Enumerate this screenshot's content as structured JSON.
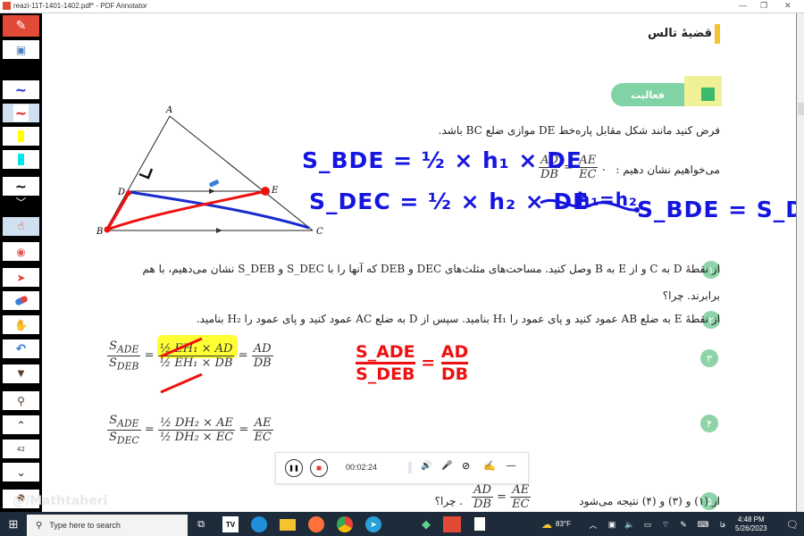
{
  "window": {
    "title": "reazi-11T-1401-1402.pdf* - PDF Annotator",
    "minimize": "—",
    "maximize": "❐",
    "close": "✕"
  },
  "toolbar": {
    "page_number": "42",
    "tools": [
      {
        "name": "app-logo",
        "glyph": "✎"
      },
      {
        "name": "save",
        "glyph": "💾"
      },
      {
        "name": "pen-blue",
        "glyph": "~",
        "color": "#1a2bd0"
      },
      {
        "name": "pen-red",
        "glyph": "~",
        "color": "#e01919"
      },
      {
        "name": "highlighter-yellow",
        "glyph": "▮",
        "color": "#ffff00"
      },
      {
        "name": "highlighter-cyan",
        "glyph": "▮",
        "color": "#00e5ee"
      },
      {
        "name": "pen-black",
        "glyph": "~",
        "color": "#111111"
      },
      {
        "name": "more-pens",
        "glyph": "﹀"
      },
      {
        "name": "hand-pointer",
        "glyph": "☝"
      },
      {
        "name": "laser",
        "glyph": "◉"
      },
      {
        "name": "select-arrow",
        "glyph": "➤"
      },
      {
        "name": "eraser",
        "glyph": "▭"
      },
      {
        "name": "hand-pan",
        "glyph": "✋"
      },
      {
        "name": "undo",
        "glyph": "↶"
      },
      {
        "name": "dropdown",
        "glyph": "▼"
      },
      {
        "name": "zoom",
        "glyph": "🔍"
      },
      {
        "name": "page-up",
        "glyph": "⌃"
      },
      {
        "name": "page-down",
        "glyph": "⌄"
      },
      {
        "name": "settings",
        "glyph": "✹"
      }
    ]
  },
  "page": {
    "heading": "قضیهٔ تالس",
    "activity_label": "فعالیت",
    "intro": "فرض کنید مانند شکل مقابل پاره‌خط DE موازی ضلع BC باشد.",
    "goal_text": "می‌خواهیم نشان دهیم :",
    "goal_fraction": {
      "left_num": "AD",
      "left_den": "DB",
      "right_num": "AE",
      "right_den": "EC"
    },
    "triangle_labels": {
      "A": "A",
      "B": "B",
      "C": "C",
      "D": "D",
      "E": "E"
    },
    "steps": [
      {
        "num": "۱",
        "line1": "از نقطهٔ D به C و از E به B وصل کنید. مساحت‌های مثلث‌های DEC و DEB که آنها را با S_DEC و S_DEB نشان می‌دهیم، با هم",
        "line2": "برابرند. چرا؟"
      },
      {
        "num": "۲",
        "line1": "از نقطهٔ E به ضلع AB عمود کنید و پای عمود را H₁ بنامید. سپس از D به ضلع AC عمود کنید و پای عمود را H₂ بنامید."
      },
      {
        "num": "۳"
      },
      {
        "num": "۴"
      },
      {
        "num": "۵",
        "line1": "از (۱) و (۳) و (۴) نتیجه می‌شود",
        "line2": ". چرا؟"
      }
    ],
    "eq3": {
      "lhs_num": "S",
      "lhs_num_sub": "ADE",
      "lhs_den": "S",
      "lhs_den_sub": "DEB",
      "mid_num": "½ EH₁ × AD",
      "mid_den": "½ EH₁ × DB",
      "rhs_num": "AD",
      "rhs_den": "DB"
    },
    "eq4": {
      "lhs_num": "S",
      "lhs_num_sub": "ADE",
      "lhs_den": "S",
      "lhs_den_sub": "DEC",
      "mid_num": "½ DH₂ × AE",
      "mid_den": "½ DH₂ × EC",
      "rhs_num": "AE",
      "rhs_den": "EC"
    },
    "eq5": {
      "left_num": "AD",
      "left_den": "DB",
      "right_num": "AE",
      "right_den": "EC"
    }
  },
  "annotations": {
    "blue_line1": "S_BDE = ½ × h₁ × DE",
    "blue_line2": "S_DEC = ½ × h₂ × DE",
    "blue_arrow_note": "h₁=h₂",
    "blue_conclusion": "S_BDE = S_DEC",
    "red_fraction": {
      "num": "S_ADE",
      "den": "S_DEB",
      "rhs_num": "AD",
      "rhs_den": "DB"
    },
    "colors": {
      "blue": "#1515e0",
      "red": "#ee1111",
      "highlight": "#ffff33"
    }
  },
  "recorder": {
    "time": "00:02:24",
    "pause_icon": "❚❚",
    "stop_icon": "■",
    "volume_icon": "🔊",
    "mic_icon": "🎤",
    "camera_off_icon": "⊘",
    "pen_icon": "✍",
    "minimize_icon": "—"
  },
  "watermark": "@/Mathtaheri",
  "taskbar": {
    "search_placeholder": "Type here to search",
    "weather": "83°F",
    "time": "4:48 PM",
    "date": "5/26/2023",
    "apps": [
      "task-view",
      "tradingview",
      "edge",
      "file-explorer",
      "firefox",
      "chrome",
      "telegram",
      "meet",
      "pdf-annotator",
      "notepad"
    ]
  }
}
